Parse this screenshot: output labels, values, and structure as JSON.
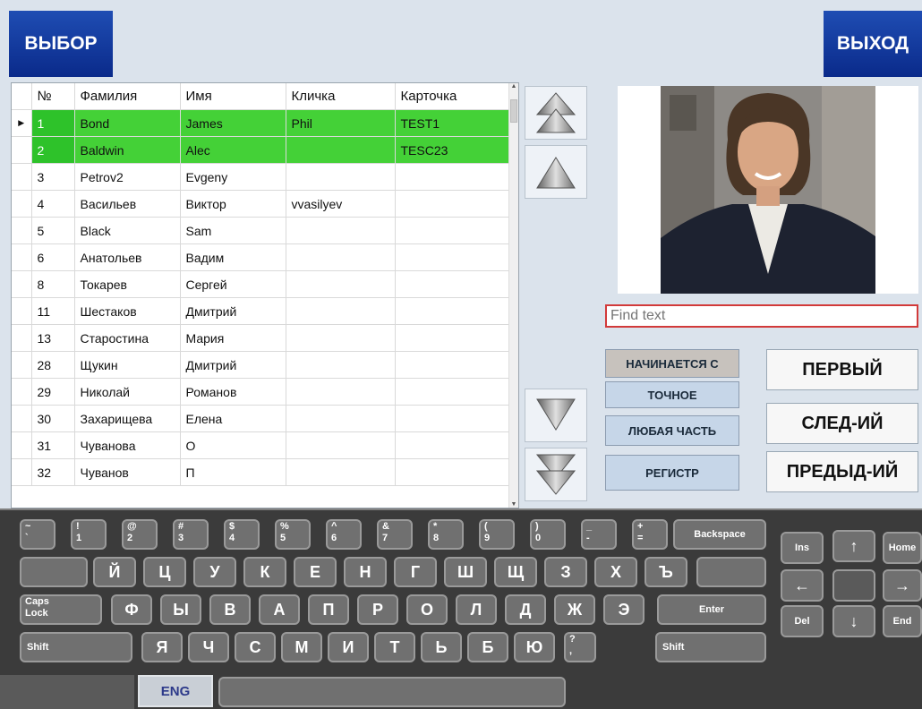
{
  "header": {
    "select_label": "ВЫБОР",
    "exit_label": "ВЫХОД"
  },
  "table": {
    "columns": [
      "№",
      "Фамилия",
      "Имя",
      "Кличка",
      "Карточка"
    ],
    "rows": [
      {
        "no": "1",
        "last": "Bond",
        "first": "James",
        "nick": "Phil",
        "card": "TEST1",
        "selected": true,
        "current": true
      },
      {
        "no": "2",
        "last": "Baldwin",
        "first": "Alec",
        "nick": "",
        "card": "TESC23",
        "selected": true
      },
      {
        "no": "3",
        "last": "Petrov2",
        "first": "Evgeny",
        "nick": "",
        "card": ""
      },
      {
        "no": "4",
        "last": "Васильев",
        "first": "Виктор",
        "nick": "vvasilyev",
        "card": ""
      },
      {
        "no": "5",
        "last": "Black",
        "first": "Sam",
        "nick": "",
        "card": ""
      },
      {
        "no": "6",
        "last": "Анатольев",
        "first": "Вадим",
        "nick": "",
        "card": ""
      },
      {
        "no": "8",
        "last": "Токарев",
        "first": "Сергей",
        "nick": "",
        "card": ""
      },
      {
        "no": "11",
        "last": "Шестаков",
        "first": "Дмитрий",
        "nick": "",
        "card": ""
      },
      {
        "no": "13",
        "last": "Старостина",
        "first": "Мария",
        "nick": "",
        "card": ""
      },
      {
        "no": "28",
        "last": "Щукин",
        "first": "Дмитрий",
        "nick": "",
        "card": ""
      },
      {
        "no": "29",
        "last": "Николай",
        "first": "Романов",
        "nick": "",
        "card": ""
      },
      {
        "no": "30",
        "last": "Захарищева",
        "first": "Елена",
        "nick": "",
        "card": ""
      },
      {
        "no": "31",
        "last": "Чуванова",
        "first": "О",
        "nick": "",
        "card": ""
      },
      {
        "no": "32",
        "last": "Чуванов",
        "first": "П",
        "nick": "",
        "card": ""
      }
    ]
  },
  "search": {
    "placeholder": "Find text"
  },
  "modes": [
    "НАЧИНАЕТСЯ С",
    "ТОЧНОЕ",
    "ЛЮБАЯ ЧАСТЬ",
    "РЕГИСТР"
  ],
  "nav": {
    "first": "ПЕРВЫЙ",
    "next": "СЛЕД-ИЙ",
    "prev": "ПРЕДЫД-ИЙ"
  },
  "keyboard": {
    "row1": [
      [
        "~",
        "`"
      ],
      [
        "!",
        "1"
      ],
      [
        "@",
        "2"
      ],
      [
        "#",
        "3"
      ],
      [
        "$",
        "4"
      ],
      [
        "%",
        "5"
      ],
      [
        "^",
        "6"
      ],
      [
        "&",
        "7"
      ],
      [
        "*",
        "8"
      ],
      [
        "(",
        "9"
      ],
      [
        ")",
        "0"
      ],
      [
        "_",
        "-"
      ],
      [
        "+",
        "="
      ]
    ],
    "backspace": "Backspace",
    "row2": [
      "Й",
      "Ц",
      "У",
      "К",
      "Е",
      "Н",
      "Г",
      "Ш",
      "Щ",
      "З",
      "Х",
      "Ъ"
    ],
    "row3": [
      "Ф",
      "Ы",
      "В",
      "А",
      "П",
      "Р",
      "О",
      "Л",
      "Д",
      "Ж",
      "Э"
    ],
    "row4": [
      "Я",
      "Ч",
      "С",
      "М",
      "И",
      "Т",
      "Ь",
      "Б",
      "Ю"
    ],
    "row4_last": [
      "?",
      ","
    ],
    "caps": "Caps Lock",
    "enter": "Enter",
    "shift": "Shift",
    "lang": "ENG",
    "nav_keys": {
      "ins": "Ins",
      "home": "Home",
      "del": "Del",
      "end": "End"
    }
  }
}
